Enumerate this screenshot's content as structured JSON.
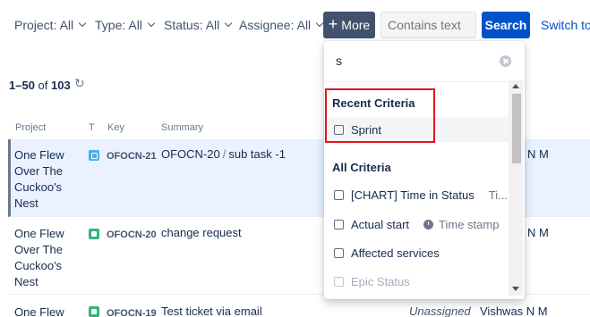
{
  "filters": {
    "project": "Project: All",
    "type": "Type: All",
    "status": "Status: All",
    "assignee": "Assignee: All"
  },
  "toolbar": {
    "more_icon": "+",
    "more_label": "More",
    "contains_placeholder": "Contains text",
    "search_label": "Search",
    "switch_label": "Switch to"
  },
  "results": {
    "range": "1–50",
    "of": "of",
    "total": "103",
    "refresh_icon": "refresh-icon"
  },
  "columns": {
    "project": "Project",
    "type": "T",
    "key": "Key",
    "summary": "Summary"
  },
  "rows": [
    {
      "project": "One Flew Over The Cuckoo's Nest",
      "type_icon": "subtask-icon",
      "key": "OFOCN-21",
      "parent": "OFOCN-20",
      "separator": "/",
      "summary": "sub task -1",
      "assignee_visible": "N M",
      "unassigned": ""
    },
    {
      "project": "One Flew Over The Cuckoo's Nest",
      "type_icon": "story-icon",
      "key": "OFOCN-20",
      "parent": "",
      "separator": "",
      "summary": "change request",
      "assignee_visible": "N M",
      "unassigned": ""
    },
    {
      "project": "One Flew",
      "type_icon": "story-icon",
      "key": "OFOCN-19",
      "parent": "",
      "separator": "",
      "summary": "Test ticket via email",
      "assignee_visible": "Vishwas N M",
      "unassigned": "Unassigned"
    }
  ],
  "dropdown": {
    "search_value": "s",
    "recent_title": "Recent Criteria",
    "recent_items": [
      "Sprint"
    ],
    "all_title": "All Criteria",
    "all_items": [
      {
        "label": "[CHART] Time in Status",
        "extra": "Ti..."
      },
      {
        "label": "Actual start",
        "extra": "Time stamp"
      },
      {
        "label": "Affected services",
        "extra": ""
      },
      {
        "label": "Epic Status",
        "extra": ""
      }
    ]
  },
  "colors": {
    "primary": "#0052cc",
    "more_button": "#42526e",
    "highlight": "#e5141c",
    "selected_row": "#e9f2fe"
  }
}
